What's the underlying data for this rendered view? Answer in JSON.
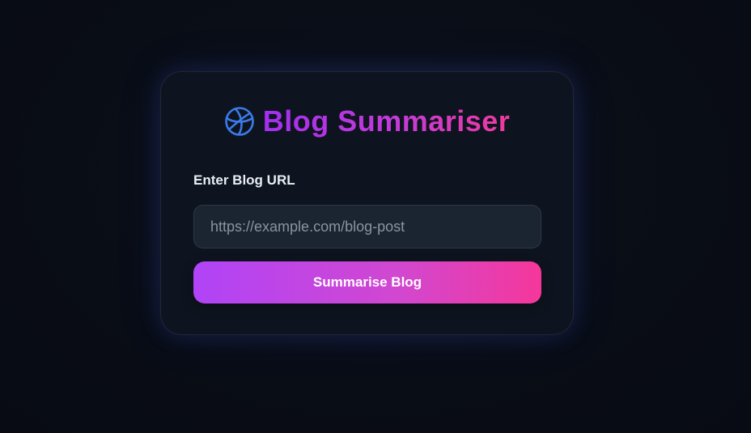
{
  "app": {
    "title": "Blog Summariser",
    "title_icon": "globe-icon"
  },
  "form": {
    "url_label": "Enter Blog URL",
    "url_value": "",
    "url_placeholder": "https://example.com/blog-post",
    "submit_label": "Summarise Blog"
  },
  "colors": {
    "background": "#090d16",
    "card": "#0e141f",
    "accent_start": "#b044f7",
    "accent_end": "#f5379a",
    "icon": "#3b7ae8"
  }
}
